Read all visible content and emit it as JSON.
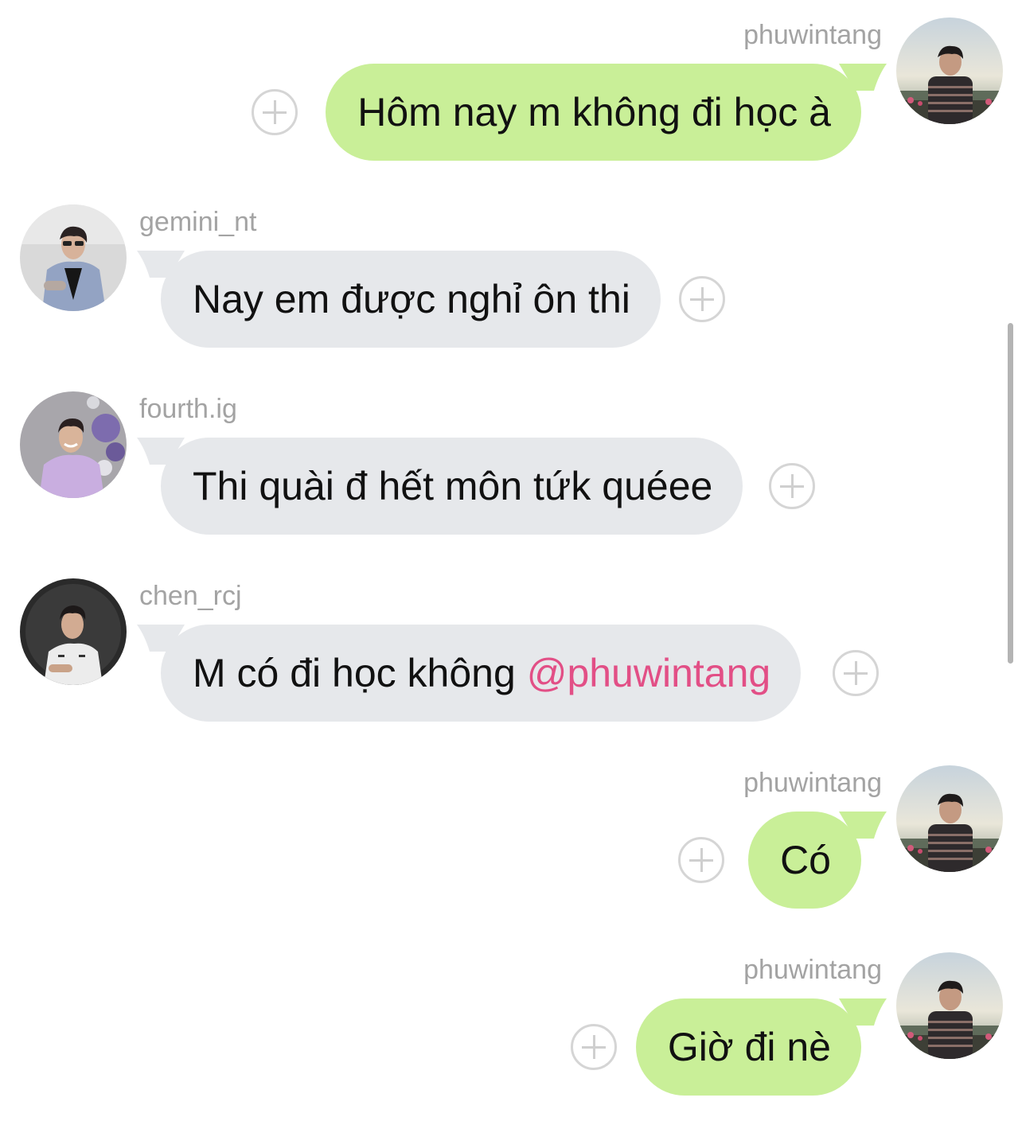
{
  "messages": [
    {
      "id": "m1",
      "direction": "out",
      "username": "phuwintang",
      "text": "Hôm nay m không đi học à",
      "avatar": "phuwintang-avatar"
    },
    {
      "id": "m2",
      "direction": "in",
      "username": "gemini_nt",
      "text": "Nay em được nghỉ ôn thi",
      "avatar": "gemini-avatar"
    },
    {
      "id": "m3",
      "direction": "in",
      "username": "fourth.ig",
      "text": "Thi quài đ hết môn tứk quéee",
      "avatar": "fourth-avatar"
    },
    {
      "id": "m4",
      "direction": "in",
      "username": "chen_rcj",
      "text": "M có đi học không ",
      "mention": "@phuwintang",
      "avatar": "chen-avatar"
    },
    {
      "id": "m5",
      "direction": "out",
      "username": "phuwintang",
      "text": "Có",
      "avatar": "phuwintang-avatar"
    },
    {
      "id": "m6",
      "direction": "out",
      "username": "phuwintang",
      "text": "Giờ đi nè",
      "avatar": "phuwintang-avatar"
    }
  ],
  "colors": {
    "outgoing_bubble": "#c9ef98",
    "incoming_bubble": "#e6e8eb",
    "username": "#a3a3a3",
    "mention": "#e24f86",
    "add_button": "#d5d5d5",
    "scrollbar": "#b4b4b4"
  },
  "icons": {
    "add_reaction": "plus-circle-icon"
  }
}
